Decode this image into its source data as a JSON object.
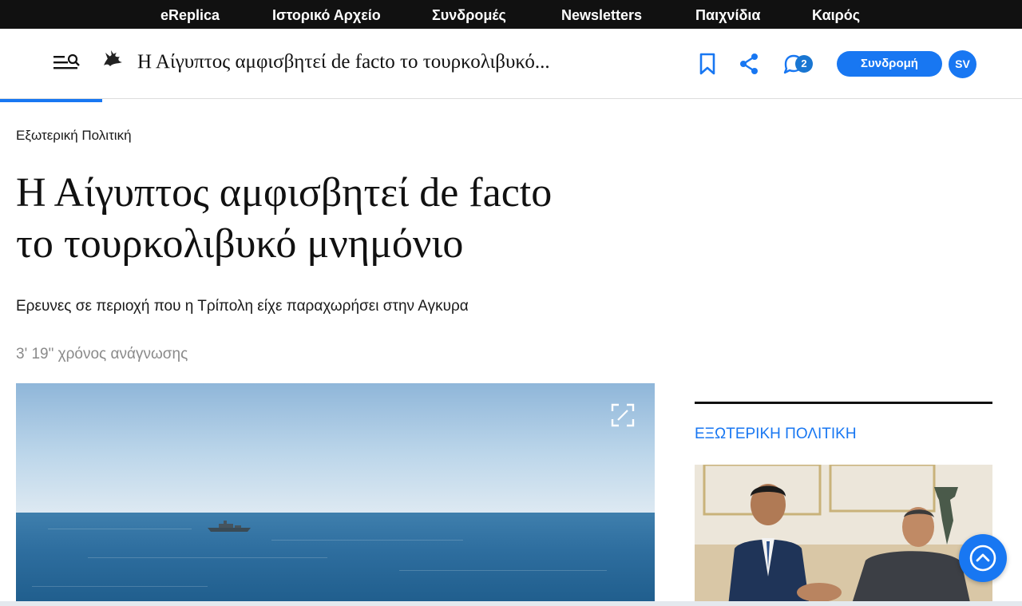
{
  "top_nav": {
    "items": [
      "eReplica",
      "Ιστορικό Αρχείο",
      "Συνδρομές",
      "Newsletters",
      "Παιχνίδια",
      "Καιρός"
    ]
  },
  "header": {
    "title": "Η Αίγυπτος αμφισβητεί de facto το τουρκολιβυκό...",
    "comment_count": "2",
    "subscribe_label": "Συνδρομή",
    "avatar_initials": "SV",
    "icons": [
      "menu-search-icon",
      "bird-logo-icon",
      "bookmark-icon",
      "share-icon",
      "comment-icon"
    ],
    "accent_color": "#1877f2"
  },
  "reading_progress": 0.1,
  "article": {
    "category": "Εξωτερική Πολιτική",
    "headline_line1": "Η Αίγυπτος αμφισβητεί de facto",
    "headline_line2": "το τουρκολιβυκό μνημόνιο",
    "subtitle": "Ερευνες σε περιοχή που η Τρίπολη είχε παραχωρήσει στην Αγκυρα",
    "reading_time": "3' 19\" χρόνος ανάγνωσης"
  },
  "sidebar": {
    "category": "ΕΞΩΤΕΡΙΚΗ ΠΟΛΙΤΙΚΗ"
  }
}
